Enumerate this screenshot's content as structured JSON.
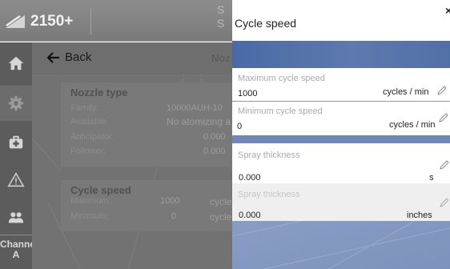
{
  "app": {
    "title": "2150+",
    "logo_icon": "atomizer-logo-icon",
    "top_strip_text": "S\nS"
  },
  "sidebar": {
    "items": [
      {
        "icon": "home-icon",
        "active": false
      },
      {
        "icon": "gear-icon",
        "active": true
      },
      {
        "icon": "first-aid-icon",
        "active": false
      },
      {
        "icon": "warning-icon",
        "active": false
      },
      {
        "icon": "users-icon",
        "active": false
      }
    ],
    "channel_label": "Channel",
    "channel_value": "A"
  },
  "content": {
    "back_label": "Back",
    "page_title": "Noz",
    "nozzle_type": {
      "title": "Nozzle type",
      "rows": [
        {
          "label": "Family:",
          "value": "10000AUH-10"
        },
        {
          "label": "Available",
          "value": "No atomizing a"
        },
        {
          "label": "Anticipator:",
          "value": "0.000"
        },
        {
          "label": "Follower:",
          "value": "0.000"
        }
      ]
    },
    "cycle_speed": {
      "title": "Cycle speed",
      "rows": [
        {
          "label": "Maximum:",
          "value": "1000",
          "unit": "cycle"
        },
        {
          "label": "Minimum:",
          "value": "0",
          "unit": "cycle"
        }
      ]
    }
  },
  "overlay": {
    "title": "Cycle speed",
    "close_label": "×",
    "fields": [
      {
        "label": "Maximum cycle speed",
        "value": "1000",
        "unit": "cycles / min"
      },
      {
        "label": "Minimum cycle speed",
        "value": "0",
        "unit": "cycles / min"
      },
      {
        "label": "Spray thickness",
        "value": "0.000",
        "unit": "s"
      },
      {
        "label": "Spray thickness",
        "value": "0.000",
        "unit": "inches"
      }
    ]
  },
  "colors": {
    "overlay_band": "#4a6aa6",
    "overlay_body": "#8ea2c7",
    "sidebar": "#5c5c5c",
    "topbar": "#8d8d8d"
  }
}
